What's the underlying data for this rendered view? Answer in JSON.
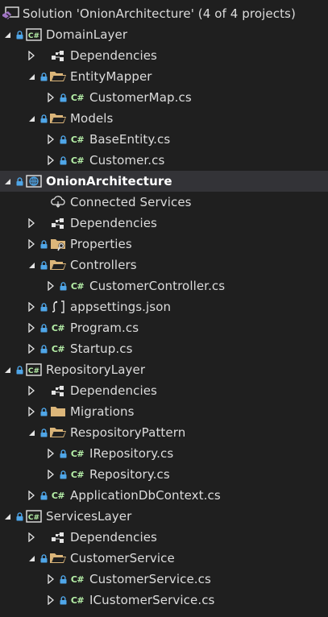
{
  "solution_explorer": {
    "items": [
      {
        "label": "Solution 'OnionArchitecture' (4 of 4 projects)",
        "depth": 0,
        "expander": "none",
        "lock": false,
        "icon": "solution-icon"
      },
      {
        "label": "DomainLayer",
        "depth": 0,
        "expander": "expanded",
        "lock": true,
        "icon": "csharp-project-icon"
      },
      {
        "label": "Dependencies",
        "depth": 1,
        "expander": "collapsed",
        "lock": false,
        "icon": "dependencies-icon"
      },
      {
        "label": "EntityMapper",
        "depth": 1,
        "expander": "expanded",
        "lock": true,
        "icon": "folder-open-icon"
      },
      {
        "label": "CustomerMap.cs",
        "depth": 2,
        "expander": "collapsed",
        "lock": true,
        "icon": "csharp-file-icon"
      },
      {
        "label": "Models",
        "depth": 1,
        "expander": "expanded",
        "lock": true,
        "icon": "folder-open-icon"
      },
      {
        "label": "BaseEntity.cs",
        "depth": 2,
        "expander": "collapsed",
        "lock": true,
        "icon": "csharp-file-icon"
      },
      {
        "label": "Customer.cs",
        "depth": 2,
        "expander": "collapsed",
        "lock": true,
        "icon": "csharp-file-icon"
      },
      {
        "label": "OnionArchitecture",
        "depth": 0,
        "expander": "expanded",
        "lock": true,
        "icon": "web-project-icon",
        "bold": true,
        "selected": true
      },
      {
        "label": "Connected Services",
        "depth": 1,
        "expander": "none",
        "lock": false,
        "icon": "connected-services-icon"
      },
      {
        "label": "Dependencies",
        "depth": 1,
        "expander": "collapsed",
        "lock": false,
        "icon": "dependencies-icon"
      },
      {
        "label": "Properties",
        "depth": 1,
        "expander": "collapsed",
        "lock": true,
        "icon": "properties-folder-icon"
      },
      {
        "label": "Controllers",
        "depth": 1,
        "expander": "expanded",
        "lock": true,
        "icon": "folder-open-icon"
      },
      {
        "label": "CustomerController.cs",
        "depth": 2,
        "expander": "collapsed",
        "lock": true,
        "icon": "csharp-file-icon"
      },
      {
        "label": "appsettings.json",
        "depth": 1,
        "expander": "collapsed",
        "lock": true,
        "icon": "json-file-icon"
      },
      {
        "label": "Program.cs",
        "depth": 1,
        "expander": "collapsed",
        "lock": true,
        "icon": "csharp-file-icon"
      },
      {
        "label": "Startup.cs",
        "depth": 1,
        "expander": "collapsed",
        "lock": true,
        "icon": "csharp-file-icon"
      },
      {
        "label": "RepositoryLayer",
        "depth": 0,
        "expander": "expanded",
        "lock": true,
        "icon": "csharp-project-icon"
      },
      {
        "label": "Dependencies",
        "depth": 1,
        "expander": "collapsed",
        "lock": false,
        "icon": "dependencies-icon"
      },
      {
        "label": "Migrations",
        "depth": 1,
        "expander": "collapsed",
        "lock": true,
        "icon": "folder-icon"
      },
      {
        "label": "RespositoryPattern",
        "depth": 1,
        "expander": "expanded",
        "lock": true,
        "icon": "folder-open-icon"
      },
      {
        "label": "IRepository.cs",
        "depth": 2,
        "expander": "collapsed",
        "lock": true,
        "icon": "csharp-file-icon"
      },
      {
        "label": "Repository.cs",
        "depth": 2,
        "expander": "collapsed",
        "lock": true,
        "icon": "csharp-file-icon"
      },
      {
        "label": "ApplicationDbContext.cs",
        "depth": 1,
        "expander": "collapsed",
        "lock": true,
        "icon": "csharp-file-icon"
      },
      {
        "label": "ServicesLayer",
        "depth": 0,
        "expander": "expanded",
        "lock": true,
        "icon": "csharp-project-icon"
      },
      {
        "label": "Dependencies",
        "depth": 1,
        "expander": "collapsed",
        "lock": false,
        "icon": "dependencies-icon"
      },
      {
        "label": "CustomerService",
        "depth": 1,
        "expander": "expanded",
        "lock": true,
        "icon": "folder-open-icon"
      },
      {
        "label": "CustomerService.cs",
        "depth": 2,
        "expander": "collapsed",
        "lock": true,
        "icon": "csharp-file-icon"
      },
      {
        "label": "ICustomerService.cs",
        "depth": 2,
        "expander": "collapsed",
        "lock": true,
        "icon": "csharp-file-icon"
      }
    ]
  },
  "colors": {
    "background": "#1f1f1f",
    "text": "#dcdcdc",
    "selected_row": "#333337",
    "folder": "#dcb67a",
    "csharp": "#b6f0a8",
    "lock": "#4fa6e8"
  },
  "glyphs": {
    "csharp_badge": "C#",
    "csharp_file": "C#"
  }
}
